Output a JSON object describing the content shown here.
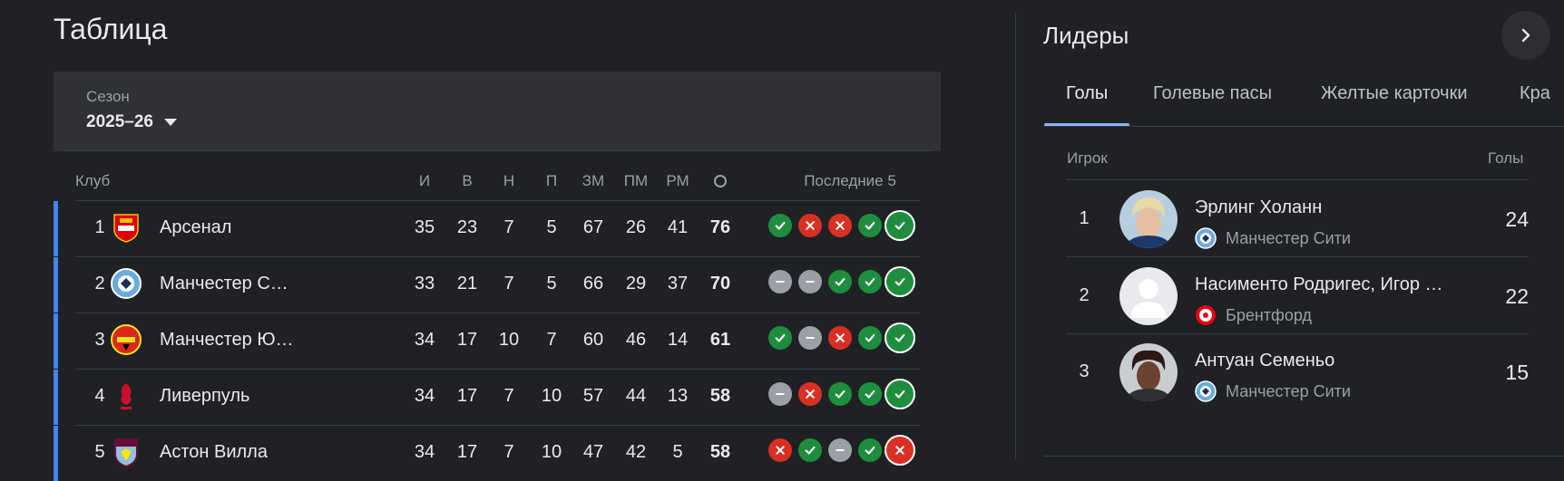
{
  "table": {
    "title": "Таблица",
    "season_label": "Сезон",
    "season_value": "2025–26",
    "headers": {
      "club": "Клуб",
      "played": "И",
      "won": "В",
      "drawn": "Н",
      "lost": "П",
      "gf": "ЗМ",
      "ga": "ПМ",
      "gd": "РМ",
      "points_icon": "points-icon",
      "last5": "Последние 5"
    },
    "rows": [
      {
        "pos": "1",
        "name": "Арсенал",
        "crest": "arsenal-crest",
        "played": "35",
        "won": "23",
        "drawn": "7",
        "lost": "5",
        "gf": "67",
        "ga": "26",
        "gd": "41",
        "pts": "76",
        "form": [
          "W",
          "L",
          "L",
          "W",
          "W"
        ]
      },
      {
        "pos": "2",
        "name": "Манчестер С…",
        "crest": "man-city-crest",
        "played": "33",
        "won": "21",
        "drawn": "7",
        "lost": "5",
        "gf": "66",
        "ga": "29",
        "gd": "37",
        "pts": "70",
        "form": [
          "D",
          "D",
          "W",
          "W",
          "W"
        ]
      },
      {
        "pos": "3",
        "name": "Манчестер Ю…",
        "crest": "man-united-crest",
        "played": "34",
        "won": "17",
        "drawn": "10",
        "lost": "7",
        "gf": "60",
        "ga": "46",
        "gd": "14",
        "pts": "61",
        "form": [
          "W",
          "D",
          "L",
          "W",
          "W"
        ]
      },
      {
        "pos": "4",
        "name": "Ливерпуль",
        "crest": "liverpool-crest",
        "played": "34",
        "won": "17",
        "drawn": "7",
        "lost": "10",
        "gf": "57",
        "ga": "44",
        "gd": "13",
        "pts": "58",
        "form": [
          "D",
          "L",
          "W",
          "W",
          "W"
        ]
      },
      {
        "pos": "5",
        "name": "Астон Вилла",
        "crest": "aston-villa-crest",
        "played": "34",
        "won": "17",
        "drawn": "7",
        "lost": "10",
        "gf": "47",
        "ga": "42",
        "gd": "5",
        "pts": "58",
        "form": [
          "L",
          "W",
          "D",
          "W",
          "L"
        ]
      }
    ]
  },
  "leaders": {
    "title": "Лидеры",
    "tabs": [
      "Голы",
      "Голевые пасы",
      "Желтые карточки",
      "Кра"
    ],
    "active_tab": "Голы",
    "header_player": "Игрок",
    "header_stat": "Голы",
    "players": [
      {
        "rank": "1",
        "name": "Эрлинг Холанн",
        "club": "Манчестер Сити",
        "value": "24",
        "club_crest": "man-city-crest"
      },
      {
        "rank": "2",
        "name": "Насименто Родригес, Игор …",
        "club": "Брентфорд",
        "value": "22",
        "club_crest": "brentford-crest"
      },
      {
        "rank": "3",
        "name": "Антуан Семеньо",
        "club": "Манчестер Сити",
        "value": "15",
        "club_crest": "man-city-crest"
      }
    ]
  },
  "colors": {
    "background": "#202124",
    "panel": "#303134",
    "accent_blue": "#4285f4",
    "tab_underline": "#8ab4f8",
    "win": "#1e8e3e",
    "loss": "#d93025",
    "draw": "#9aa0a6"
  }
}
